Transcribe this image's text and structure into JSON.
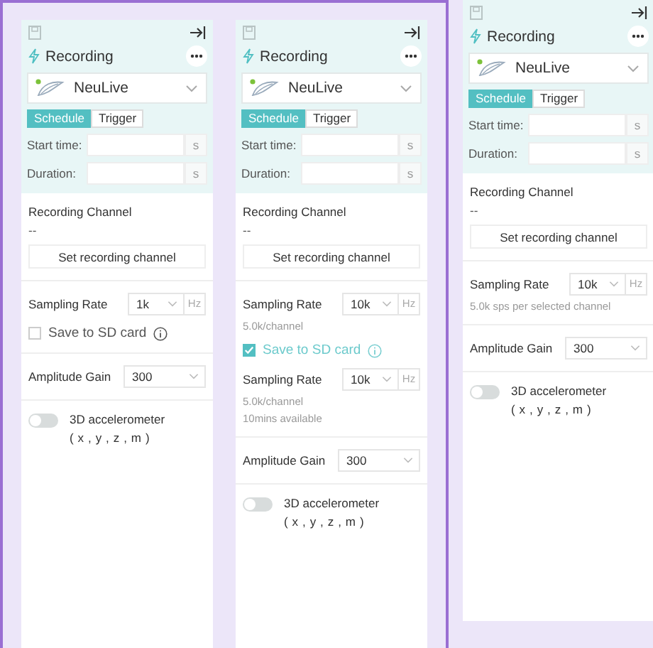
{
  "groups": [
    {
      "framed": true,
      "panels": [
        {
          "title": "Recording",
          "device": "NeuLive",
          "tabs": [
            {
              "label": "Schedule",
              "selected": true
            },
            {
              "label": "Trigger",
              "selected": false
            }
          ],
          "fields": [
            {
              "label": "Start time:",
              "unit": "s"
            },
            {
              "label": "Duration:",
              "unit": "s"
            }
          ],
          "channel_label": "Recording Channel",
          "channel_value": "--",
          "channel_button": "Set recording channel",
          "sections": [
            [
              {
                "kind": "rate",
                "label": "Sampling Rate",
                "value": "1k",
                "unit": "Hz"
              },
              {
                "kind": "checkbox",
                "label": "Save to SD card",
                "checked": false
              }
            ],
            [
              {
                "kind": "select",
                "label": "Amplitude Gain",
                "value": "300"
              }
            ],
            [
              {
                "kind": "toggle",
                "label": "3D accelerometer",
                "sub": "( x , y , z , m )",
                "on": false
              }
            ]
          ]
        },
        {
          "title": "Recording",
          "device": "NeuLive",
          "tabs": [
            {
              "label": "Schedule",
              "selected": true
            },
            {
              "label": "Trigger",
              "selected": false
            }
          ],
          "fields": [
            {
              "label": "Start time:",
              "unit": "s"
            },
            {
              "label": "Duration:",
              "unit": "s"
            }
          ],
          "channel_label": "Recording Channel",
          "channel_value": "--",
          "channel_button": "Set recording channel",
          "sections": [
            [
              {
                "kind": "rate",
                "label": "Sampling Rate",
                "value": "10k",
                "unit": "Hz"
              },
              {
                "kind": "note",
                "text": "5.0k/channel"
              },
              {
                "kind": "checkbox",
                "label": "Save to SD card",
                "checked": true
              },
              {
                "kind": "rate",
                "label": "Sampling Rate",
                "value": "10k",
                "unit": "Hz"
              },
              {
                "kind": "note",
                "text": "5.0k/channel"
              },
              {
                "kind": "note",
                "text": "10mins available"
              }
            ],
            [
              {
                "kind": "select",
                "label": "Amplitude Gain",
                "value": "300"
              }
            ],
            [
              {
                "kind": "toggle",
                "label": "3D accelerometer",
                "sub": "( x , y , z , m )",
                "on": false
              }
            ]
          ]
        }
      ]
    },
    {
      "framed": false,
      "panels": [
        {
          "title": "Recording",
          "device": "NeuLive",
          "tabs": [
            {
              "label": "Schedule",
              "selected": true
            },
            {
              "label": "Trigger",
              "selected": false
            }
          ],
          "fields": [
            {
              "label": "Start time:",
              "unit": "s"
            },
            {
              "label": "Duration:",
              "unit": "s"
            }
          ],
          "channel_label": "Recording Channel",
          "channel_value": "--",
          "channel_button": "Set recording channel",
          "sections": [
            [
              {
                "kind": "rate",
                "label": "Sampling Rate",
                "value": "10k",
                "unit": "Hz"
              },
              {
                "kind": "note",
                "text": "5.0k sps per selected channel"
              }
            ],
            [
              {
                "kind": "select",
                "label": "Amplitude Gain",
                "value": "300"
              }
            ],
            [
              {
                "kind": "toggle",
                "label": "3D accelerometer",
                "sub": "( x , y , z , m )",
                "on": false
              }
            ]
          ]
        }
      ]
    }
  ]
}
